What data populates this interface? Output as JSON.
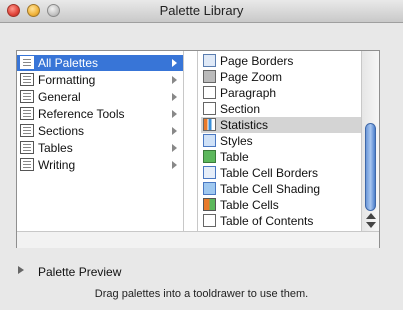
{
  "window": {
    "title": "Palette Library"
  },
  "categories": [
    {
      "label": "All Palettes",
      "selected": true
    },
    {
      "label": "Formatting"
    },
    {
      "label": "General"
    },
    {
      "label": "Reference Tools"
    },
    {
      "label": "Sections"
    },
    {
      "label": "Tables"
    },
    {
      "label": "Writing"
    }
  ],
  "palettes": [
    {
      "label": "Page Borders",
      "icon": "page-borders-icon"
    },
    {
      "label": "Page Zoom",
      "icon": "page-zoom-icon"
    },
    {
      "label": "Paragraph",
      "icon": "paragraph-icon"
    },
    {
      "label": "Section",
      "icon": "section-icon"
    },
    {
      "label": "Statistics",
      "icon": "statistics-icon",
      "highlighted": true
    },
    {
      "label": "Styles",
      "icon": "styles-icon"
    },
    {
      "label": "Table",
      "icon": "table-icon"
    },
    {
      "label": "Table Cell Borders",
      "icon": "table-cell-borders-icon"
    },
    {
      "label": "Table Cell Shading",
      "icon": "table-cell-shading-icon"
    },
    {
      "label": "Table Cells",
      "icon": "table-cells-icon"
    },
    {
      "label": "Table of Contents",
      "icon": "table-of-contents-icon"
    }
  ],
  "preview": {
    "label": "Palette Preview"
  },
  "hint": "Drag palettes into a tooldrawer to use them.",
  "colors": {
    "selection": "#3875d7",
    "highlight": "#d4d4d4"
  }
}
